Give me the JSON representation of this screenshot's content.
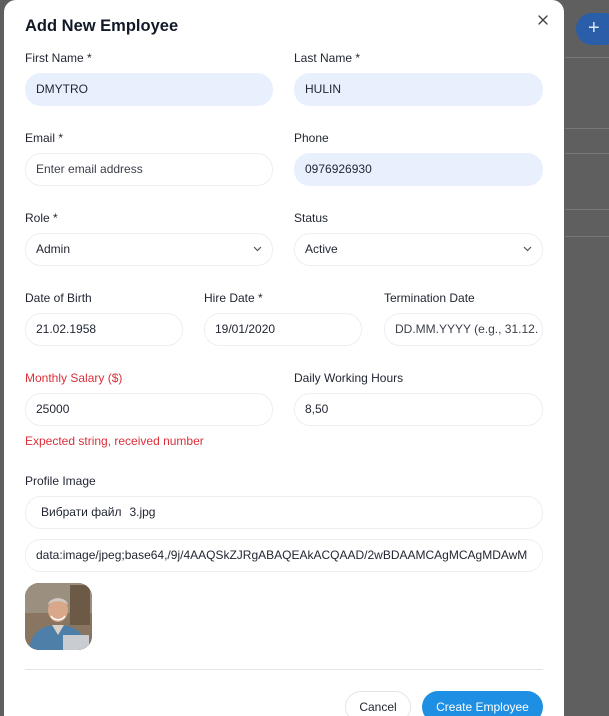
{
  "modal": {
    "title": "Add New Employee",
    "close_icon": "close-icon"
  },
  "fields": {
    "first_name": {
      "label": "First Name *",
      "value": "DMYTRO"
    },
    "last_name": {
      "label": "Last Name *",
      "value": "HULIN"
    },
    "email": {
      "label": "Email *",
      "placeholder": "Enter email address"
    },
    "phone": {
      "label": "Phone",
      "value": "0976926930"
    },
    "role": {
      "label": "Role *",
      "value": "Admin"
    },
    "status": {
      "label": "Status",
      "value": "Active"
    },
    "date_of_birth": {
      "label": "Date of Birth",
      "value": "21.02.1958"
    },
    "hire_date": {
      "label": "Hire Date *",
      "value": "19/01/2020"
    },
    "termination_date": {
      "label": "Termination Date",
      "placeholder": "DD.MM.YYYY (e.g., 31.12."
    },
    "monthly_salary": {
      "label": "Monthly Salary ($)",
      "value": "25000",
      "error": "Expected string, received number"
    },
    "daily_working_hours": {
      "label": "Daily Working Hours",
      "value": "8,50"
    },
    "profile_image": {
      "label": "Profile Image",
      "file_button": "Вибрати файл",
      "file_name": "3.jpg",
      "data_url": "data:image/jpeg;base64,/9j/4AAQSkZJRgABAQEAkACQAAD/2wBDAAMCAgMCAgMDAwM"
    }
  },
  "actions": {
    "cancel": "Cancel",
    "create": "Create Employee"
  },
  "colors": {
    "accent": "#1e8fe3",
    "error": "#dc2f3a",
    "filled_input": "#e8f0fe"
  }
}
